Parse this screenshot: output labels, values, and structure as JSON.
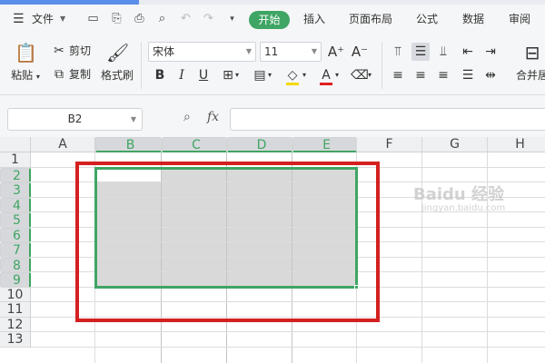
{
  "menubar": {
    "file_label": "文件",
    "tabs": [
      "开始",
      "插入",
      "页面布局",
      "公式",
      "数据",
      "审阅"
    ],
    "active_tab": "开始"
  },
  "ribbon": {
    "paste_label": "粘贴",
    "cut_label": "剪切",
    "copy_label": "复制",
    "format_painter_label": "格式刷",
    "font_name": "宋体",
    "font_size": "11",
    "merge_label": "合并居"
  },
  "formula_bar": {
    "name_box": "B2",
    "fx_label": "fx",
    "formula_value": ""
  },
  "sheet": {
    "columns": [
      "A",
      "B",
      "C",
      "D",
      "E",
      "F",
      "G",
      "H"
    ],
    "rows": [
      "1",
      "2",
      "3",
      "4",
      "5",
      "6",
      "7",
      "8",
      "9",
      "10",
      "11",
      "12",
      "13"
    ],
    "selection": "B2:E9",
    "selected_columns": [
      "B",
      "C",
      "D",
      "E"
    ],
    "selected_rows": [
      "2",
      "3",
      "4",
      "5",
      "6",
      "7",
      "8",
      "9"
    ]
  },
  "colors": {
    "accent": "#3fa564",
    "highlight_box": "#d42020",
    "selection_fill": "#d9d9d9"
  },
  "watermark": {
    "text": "Baidu 经验",
    "sub": "jingyan.baidu.com"
  }
}
